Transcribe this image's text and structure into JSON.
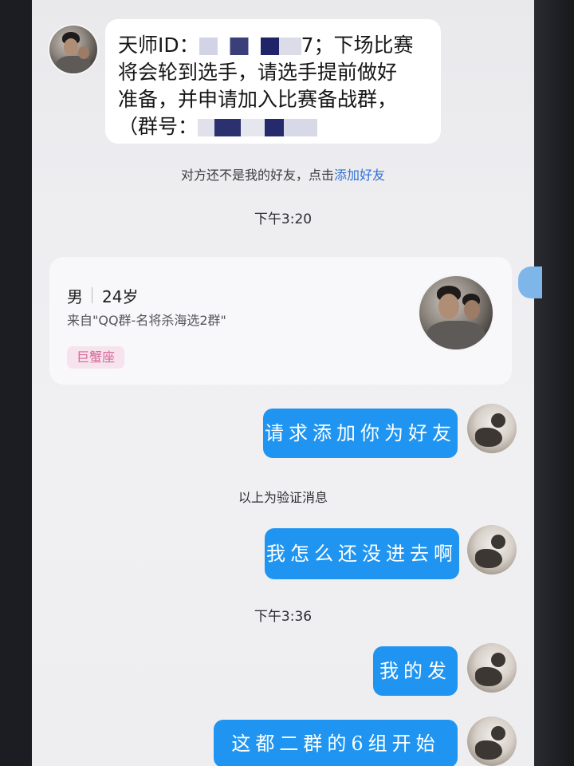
{
  "messages": {
    "incoming": {
      "prefix": "天师ID：",
      "id_suffix": "7",
      "line1_tail": "；下场比赛",
      "line2": "将会轮到选手，请选手提前做好",
      "line3": "准备，并申请加入比赛备战群，",
      "line4_prefix": "（群号："
    },
    "system_notice": {
      "text": "对方还不是我的好友，点击",
      "link": "添加好友"
    },
    "time1": "下午3:20",
    "profile_card": {
      "gender": "男",
      "age": "24岁",
      "source": "来自\"QQ群-名将杀海选2群\"",
      "tag": "巨蟹座"
    },
    "request_message": "请求添加你为好友",
    "verification_note": "以上为验证消息",
    "sent1": "我怎么还没进去啊",
    "time2": "下午3:36",
    "sent2": "我的发",
    "sent3": "这都二群的6组开始了。"
  },
  "colors": {
    "bubble_blue": "#1f95f1",
    "tag_pink_bg": "#f6e3ec",
    "tag_pink_text": "#d5689a",
    "link_blue": "#2f6fd4"
  }
}
